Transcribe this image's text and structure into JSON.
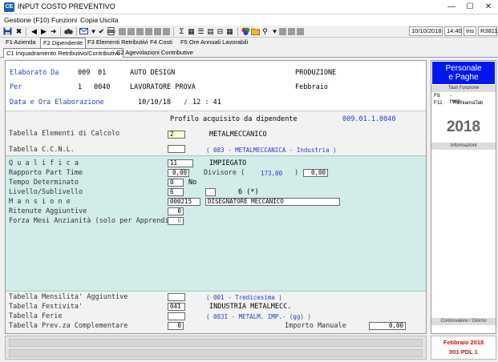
{
  "window": {
    "title": "INPUT COSTO PREVENTIVO",
    "app_icon_text": "CE",
    "minimize": "—",
    "maximize": "☐",
    "close": "✕"
  },
  "menu": [
    "Gestione (F10)",
    "Funzioni",
    "Copia",
    "Uscita"
  ],
  "toolbar": {
    "status": {
      "date": "10/10/2018",
      "time": "14:40",
      "mode": "Ins",
      "code": "R3811"
    }
  },
  "tabs_row1": [
    {
      "label": "F1 Azienda",
      "active": false
    },
    {
      "label": "F2 Dipendente",
      "active": true
    },
    {
      "label": "F3 Elementi Retributivi",
      "active": false
    },
    {
      "label": "F4 Costi",
      "active": false
    },
    {
      "label": "F5 Ore Annuali Lavorabili",
      "active": false
    }
  ],
  "tabs_row2": [
    {
      "label": "C1 Inquadramento Retributivo/Contributivo",
      "active": true
    },
    {
      "label": "C2 Agevolazioni Contributive",
      "active": false
    }
  ],
  "header": {
    "elaborato_label": "Elaborato Da",
    "elaborato_code1": "009",
    "elaborato_code2": "01",
    "elaborato_name": "AUTO DESIGN",
    "elaborato_dept": "PRODUZIONE",
    "per_label": "Per",
    "per_code1": "1",
    "per_code2": "0040",
    "per_name": "LAVORATORE PROVA",
    "per_month": "Febbraio",
    "data_label": "Data e Ora Elaborazione",
    "data_date": "10/10/18",
    "data_sep": "/",
    "data_time": "12 : 41"
  },
  "profile": {
    "title": "Profilo acquisito da dipendente",
    "code": "009.01.1.0040",
    "elementi_label": "Tabella Elementi di Calcolo",
    "elementi_value": "2",
    "elementi_desc": "METALMECCANICO",
    "ccnl_label": "Tabella C.C.N.L.",
    "ccnl_value": "",
    "ccnl_desc": "( 083 - METALMECCANICA   - Industria )"
  },
  "teal": {
    "qualifica_label": "Q u a l i f i c a",
    "qualifica_value": "11",
    "qualifica_desc": "IMPIEGATO",
    "parttime_label": "Rapporto Part Time",
    "parttime_value": "0,00",
    "divisore_label": "Divisore (",
    "divisore_value": "173,00",
    "divisore_close": ")",
    "divisore_field": "0,00",
    "tempo_label": "Tempo Determinato",
    "tempo_value": "0",
    "tempo_desc": "No",
    "livello_label": "Livello/Sublivello",
    "livello_value": "6",
    "sublivello_value": "",
    "livello_desc": "6 (*)",
    "mansione_label": "M a n s i o n e",
    "mansione_value": "000215",
    "mansione_desc": "DISEGNATORE MECCANICO",
    "ritenute_label": "Ritenute Aggiuntive",
    "ritenute_value": "0",
    "forza_label": "Forza Mesi Anzianità (solo per Apprendisti)",
    "forza_value": "0"
  },
  "bottom": {
    "mensilita_label": "Tabella Mensilita' Aggiuntive",
    "mensilita_value": "",
    "mensilita_desc": "( 001 - Tredicesima )",
    "festivita_label": "Tabella Festivita'",
    "festivita_value": "041",
    "festivita_desc": "INDUSTRIA METALMECC.",
    "ferie_label": "Tabella Ferie",
    "ferie_value": "",
    "ferie_desc": "( 083I - METALM. IMP.- (gg) )",
    "prev_label": "Tabella Prev.za Complementare",
    "prev_value": "0",
    "importo_label": "Importo Manuale",
    "importo_value": "0,00"
  },
  "right_panel": {
    "brand_line1": "Personale",
    "brand_line2": "e Paghe",
    "tasti_caption": "Tasti Funzione",
    "fkeys": [
      {
        "key": "F9",
        "desc": "- Help"
      },
      {
        "key": "F11",
        "desc": "- RichiamaTab"
      }
    ],
    "year": "2018",
    "informazioni_caption": "Informazioni",
    "controvalore_caption": "Controvalore / Giorno",
    "footer_line1": "Febbraio  2018",
    "footer_line2": "001 PDL 1"
  },
  "colors": {
    "brand_bg": "#0018ee",
    "header_blue": "#1f3fbf",
    "teal_bg": "#d2ecea",
    "footer_red": "#cc1111"
  }
}
